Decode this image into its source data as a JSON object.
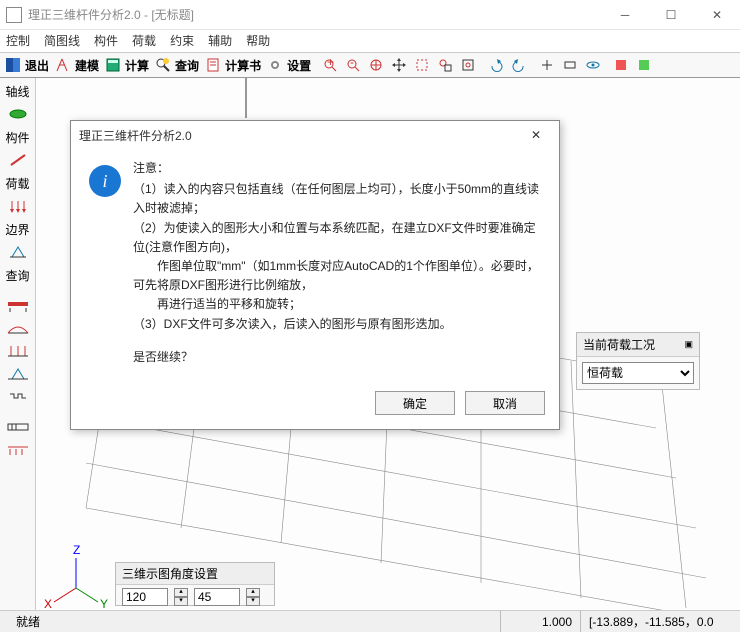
{
  "window": {
    "title": "理正三维杆件分析2.0 - [无标题]"
  },
  "menu": [
    "控制",
    "简图线",
    "构件",
    "荷载",
    "约束",
    "辅助",
    "帮助"
  ],
  "toolbar_labels": {
    "exit": "退出",
    "model": "建模",
    "calc": "计算",
    "query": "查询",
    "calc2": "计算书",
    "set": "设置"
  },
  "sidebar": [
    "轴线",
    "构件",
    "荷载",
    "边界",
    "查询"
  ],
  "dialog": {
    "title": "理正三维杆件分析2.0",
    "heading": "注意：",
    "l1": "（1）读入的内容只包括直线（在任何图层上均可），长度小于50mm的直线读入时被滤掉；",
    "l2": "（2）为使读入的图形大小和位置与本系统匹配，在建立DXF文件时要准确定位(注意作图方向)，",
    "l3": "　　作图单位取\"mm\"（如1mm长度对应AutoCAD的1个作图单位）。必要时，可先将原DXF图形进行比例缩放，",
    "l4": "　　再进行适当的平移和旋转；",
    "l5": "（3）DXF文件可多次读入，后读入的图形与原有图形迭加。",
    "q": "是否继续？",
    "ok": "确定",
    "cancel": "取消"
  },
  "panel": {
    "title": "当前荷载工况",
    "value": "恒荷载"
  },
  "angle": {
    "title": "三维示图角度设置",
    "v1": "120",
    "v2": "45"
  },
  "status": {
    "ready": "就绪",
    "scale": "1.000",
    "coord": "[-13.889，-11.585，0.0"
  }
}
